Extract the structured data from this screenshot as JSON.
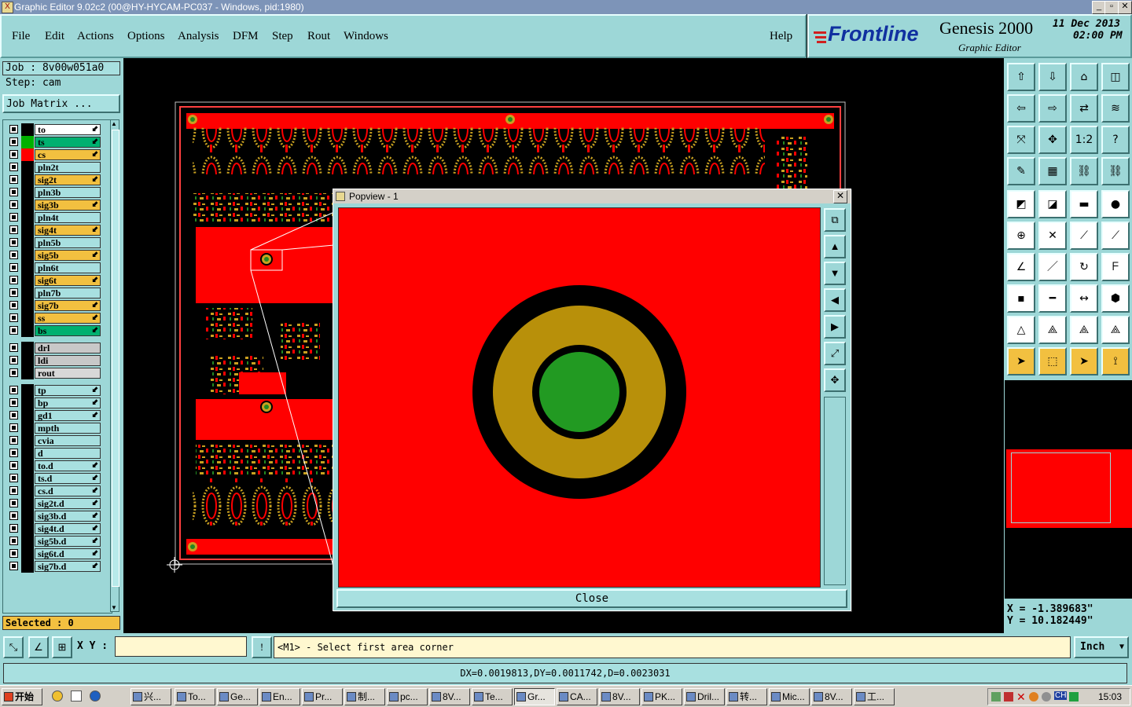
{
  "window": {
    "title": "Graphic Editor 9.02c2 (00@HY-HYCAM-PC037 - Windows, pid:1980)"
  },
  "menu": [
    "File",
    "Edit",
    "Actions",
    "Options",
    "Analysis",
    "DFM",
    "Step",
    "Rout",
    "Windows"
  ],
  "help_label": "Help",
  "brand": {
    "logo": "Frontline",
    "product": "Genesis 2000",
    "subtitle": "Graphic Editor",
    "date": "11 Dec 2013",
    "time": "02:00 PM"
  },
  "job": {
    "job_label": "Job : 8v00w051a0",
    "step_label": "Step: cam",
    "matrix_button": "Job Matrix ..."
  },
  "layers": [
    {
      "name": "to",
      "bg": "#ffffff",
      "sw": "#000000"
    },
    {
      "name": "ts",
      "bg": "#00b070",
      "sw": "#00b000"
    },
    {
      "name": "cs",
      "bg": "#f2c040",
      "sw": "#ff0000"
    },
    {
      "name": "pln2t",
      "bg": "#a8e0e0",
      "sw": "#000000"
    },
    {
      "name": "sig2t",
      "bg": "#f2c040",
      "sw": "#000000"
    },
    {
      "name": "pln3b",
      "bg": "#a8e0e0",
      "sw": "#000000"
    },
    {
      "name": "sig3b",
      "bg": "#f2c040",
      "sw": "#000000"
    },
    {
      "name": "pln4t",
      "bg": "#a8e0e0",
      "sw": "#000000"
    },
    {
      "name": "sig4t",
      "bg": "#f2c040",
      "sw": "#000000"
    },
    {
      "name": "pln5b",
      "bg": "#a8e0e0",
      "sw": "#000000"
    },
    {
      "name": "sig5b",
      "bg": "#f2c040",
      "sw": "#000000"
    },
    {
      "name": "pln6t",
      "bg": "#a8e0e0",
      "sw": "#000000"
    },
    {
      "name": "sig6t",
      "bg": "#f2c040",
      "sw": "#000000"
    },
    {
      "name": "pln7b",
      "bg": "#a8e0e0",
      "sw": "#000000"
    },
    {
      "name": "sig7b",
      "bg": "#f2c040",
      "sw": "#000000"
    },
    {
      "name": "ss",
      "bg": "#f2c040",
      "sw": "#000000"
    },
    {
      "name": "bs",
      "bg": "#00b070",
      "sw": "#000000"
    },
    {
      "name": "drl",
      "bg": "#c8c8c8",
      "sw": "#000000"
    },
    {
      "name": "ldi",
      "bg": "#c8c8c8",
      "sw": "#000000"
    },
    {
      "name": "rout",
      "bg": "#d8d8d8",
      "sw": "#000000"
    },
    {
      "name": "tp",
      "bg": "#a8e0e0",
      "sw": "#000000"
    },
    {
      "name": "bp",
      "bg": "#a8e0e0",
      "sw": "#000000"
    },
    {
      "name": "gd1",
      "bg": "#a8e0e0",
      "sw": "#000000"
    },
    {
      "name": "mpth",
      "bg": "#a8e0e0",
      "sw": "#000000"
    },
    {
      "name": "cvia",
      "bg": "#a8e0e0",
      "sw": "#000000"
    },
    {
      "name": "d",
      "bg": "#a8e0e0",
      "sw": "#000000"
    },
    {
      "name": "to.d",
      "bg": "#a8e0e0",
      "sw": "#000000"
    },
    {
      "name": "ts.d",
      "bg": "#a8e0e0",
      "sw": "#000000"
    },
    {
      "name": "cs.d",
      "bg": "#a8e0e0",
      "sw": "#000000"
    },
    {
      "name": "sig2t.d",
      "bg": "#a8e0e0",
      "sw": "#000000"
    },
    {
      "name": "sig3b.d",
      "bg": "#a8e0e0",
      "sw": "#000000"
    },
    {
      "name": "sig4t.d",
      "bg": "#a8e0e0",
      "sw": "#000000"
    },
    {
      "name": "sig5b.d",
      "bg": "#a8e0e0",
      "sw": "#000000"
    },
    {
      "name": "sig6t.d",
      "bg": "#a8e0e0",
      "sw": "#000000"
    },
    {
      "name": "sig7b.d",
      "bg": "#a8e0e0",
      "sw": "#000000"
    }
  ],
  "selected": "Selected : 0",
  "popview": {
    "title": "Popview - 1",
    "close_label": "Close"
  },
  "coords": {
    "x": "X = -1.389683\"",
    "y": "Y = 10.182449\""
  },
  "command": {
    "xy_label": "X Y :",
    "xy_value": "",
    "prompt": "<M1> - Select first area corner",
    "units": "Inch"
  },
  "status": "DX=0.0019813,DY=0.0011742,D=0.0023031",
  "taskbar": {
    "start": "开始",
    "tasks": [
      "兴...",
      "To...",
      "Ge...",
      "En...",
      "Pr...",
      "制...",
      "pc...",
      "8V...",
      "Te...",
      "Gr...",
      "CA...",
      "8V...",
      "PK...",
      "Dril...",
      "转...",
      "Mic...",
      "8V...",
      "工..."
    ],
    "tray_lang": "CH",
    "clock": "15:03"
  },
  "colors": {
    "panel": "#9dd7d7",
    "copper": "#ff0000",
    "pad_ring": "#b8900a",
    "drill": "#229a22"
  }
}
